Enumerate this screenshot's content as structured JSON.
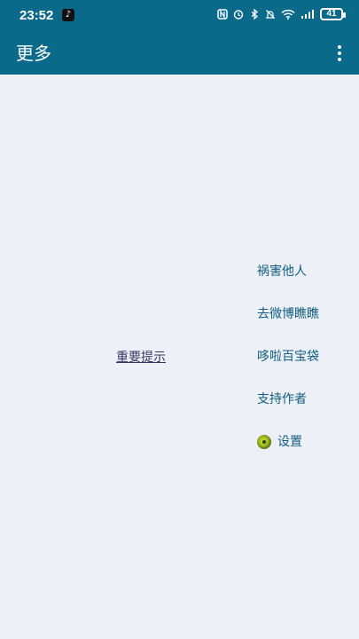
{
  "status_bar": {
    "time": "23:52",
    "battery": "41"
  },
  "toolbar": {
    "title": "更多"
  },
  "notice": {
    "label": "重要提示"
  },
  "menu": {
    "items": [
      {
        "label": "祸害他人"
      },
      {
        "label": "去微博瞧瞧"
      },
      {
        "label": "哆啦百宝袋"
      },
      {
        "label": "支持作者"
      },
      {
        "label": "设置",
        "icon": "settings-ball-icon"
      }
    ]
  },
  "colors": {
    "header": "#0b6a8a",
    "background": "#edf1f7",
    "menu_text": "#0f5d80",
    "notice_text": "#3a3560"
  }
}
